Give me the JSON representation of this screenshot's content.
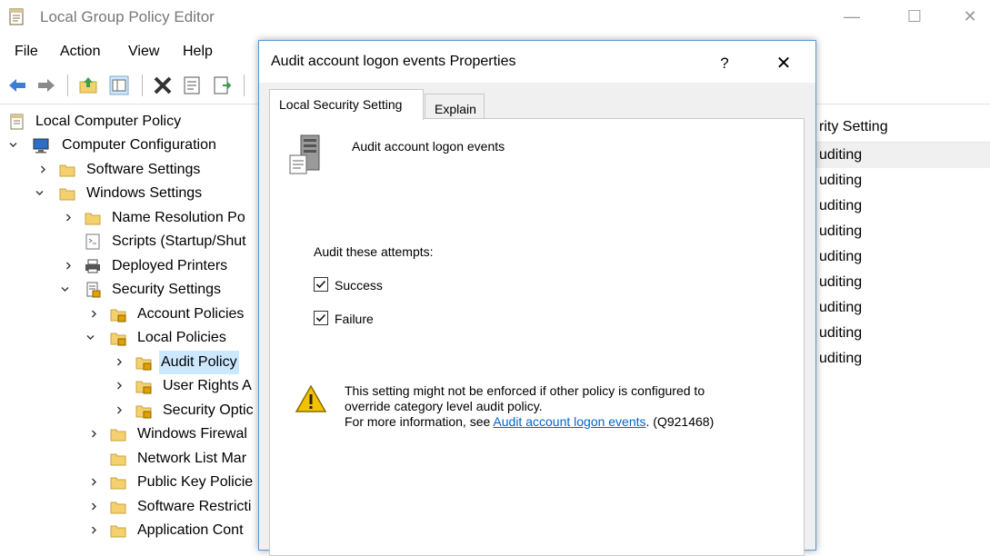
{
  "window": {
    "title": "Local Group Policy Editor",
    "minimize_glyph": "—",
    "maximize_glyph": "☐",
    "close_glyph": "✕"
  },
  "menu": {
    "items": [
      {
        "label": "File"
      },
      {
        "label": "Action"
      },
      {
        "label": "View"
      },
      {
        "label": "Help"
      }
    ]
  },
  "toolbar": {
    "icons": [
      "back-arrow-icon",
      "forward-arrow-icon",
      "up-folder-icon",
      "show-hide-tree-icon",
      "delete-icon",
      "properties-icon",
      "export-list-icon"
    ]
  },
  "tree": {
    "items": [
      {
        "label": "Local Computer Policy"
      },
      {
        "label": "Computer Configuration"
      },
      {
        "label": "Software Settings"
      },
      {
        "label": "Windows Settings"
      },
      {
        "label": "Name Resolution Po"
      },
      {
        "label": "Scripts (Startup/Shut"
      },
      {
        "label": "Deployed Printers"
      },
      {
        "label": "Security Settings"
      },
      {
        "label": "Account Policies"
      },
      {
        "label": "Local Policies"
      },
      {
        "label": "Audit Policy"
      },
      {
        "label": "User Rights A"
      },
      {
        "label": "Security Optic"
      },
      {
        "label": "Windows Firewal"
      },
      {
        "label": "Network List Mar"
      },
      {
        "label": "Public Key Policie"
      },
      {
        "label": "Software Restricti"
      },
      {
        "label": "Application Cont"
      }
    ]
  },
  "right_pane": {
    "header": "rity Setting",
    "rows": [
      "uditing",
      "uditing",
      "uditing",
      "uditing",
      "uditing",
      "uditing",
      "uditing",
      "uditing",
      "uditing"
    ]
  },
  "dialog": {
    "title": "Audit account logon events Properties",
    "help_glyph": "?",
    "close_glyph": "✕",
    "tabs": [
      {
        "label": "Local Security Setting",
        "active": true
      },
      {
        "label": "Explain",
        "active": false
      }
    ],
    "policy_name": "Audit account logon events",
    "attempts_label": "Audit these attempts:",
    "success": {
      "label": "Success",
      "checked": true
    },
    "failure": {
      "label": "Failure",
      "checked": true
    },
    "warning": {
      "line1": "This setting might not be enforced if other policy is configured to",
      "line2": "override category level audit policy.",
      "line3_prefix": "For more information, see ",
      "link_text": "Audit account logon events",
      "line3_suffix": ". (Q921468)"
    }
  },
  "colors": {
    "selection": "#cce8ff",
    "dialog_border": "#5b9bd5",
    "link": "#0066cc",
    "folder": "#f4d06f",
    "lock": "#e0a000"
  }
}
